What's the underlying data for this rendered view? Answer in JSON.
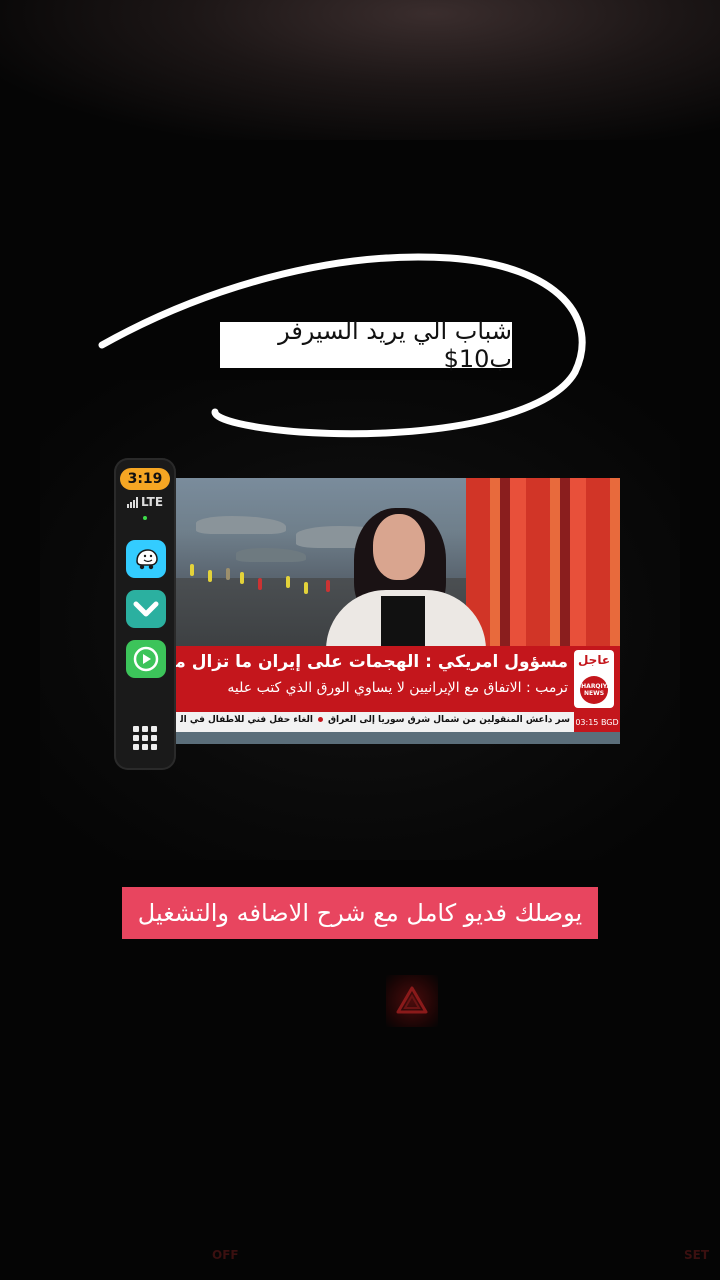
{
  "overlay": {
    "top_sticker": "شباب الي يريد السيرفر ب10$",
    "bottom_sticker": "يوصلك فديو كامل مع شرح الاضافه والتشغيل"
  },
  "carplay": {
    "time": "3:19",
    "network": "LTE",
    "apps": [
      {
        "name": "waze-icon"
      },
      {
        "name": "vpn-icon"
      },
      {
        "name": "media-player-icon"
      }
    ],
    "accent_color": "#f5a623"
  },
  "tv": {
    "badge_label": "عاجل",
    "channel_logo": "SHARQIYA NEWS",
    "headline_main": "مسؤول امريكي : الهجمات على إيران ما تزال متواصلة",
    "headline_sub": "ترمب : الاتفاق مع الإيرانيين لا يساوي الورق الذي كتب عليه",
    "ticker_time": "03:15 BGD",
    "ticker_items": [
      "سر داعش المنقولين من شمال شرق سوريا إلى العراق",
      "الغاء حفل فني للاطفال في البصرة بعد ت"
    ],
    "brand_color": "#c4161c"
  },
  "dashboard": {
    "left_label": "OFF",
    "right_label": "SET"
  }
}
